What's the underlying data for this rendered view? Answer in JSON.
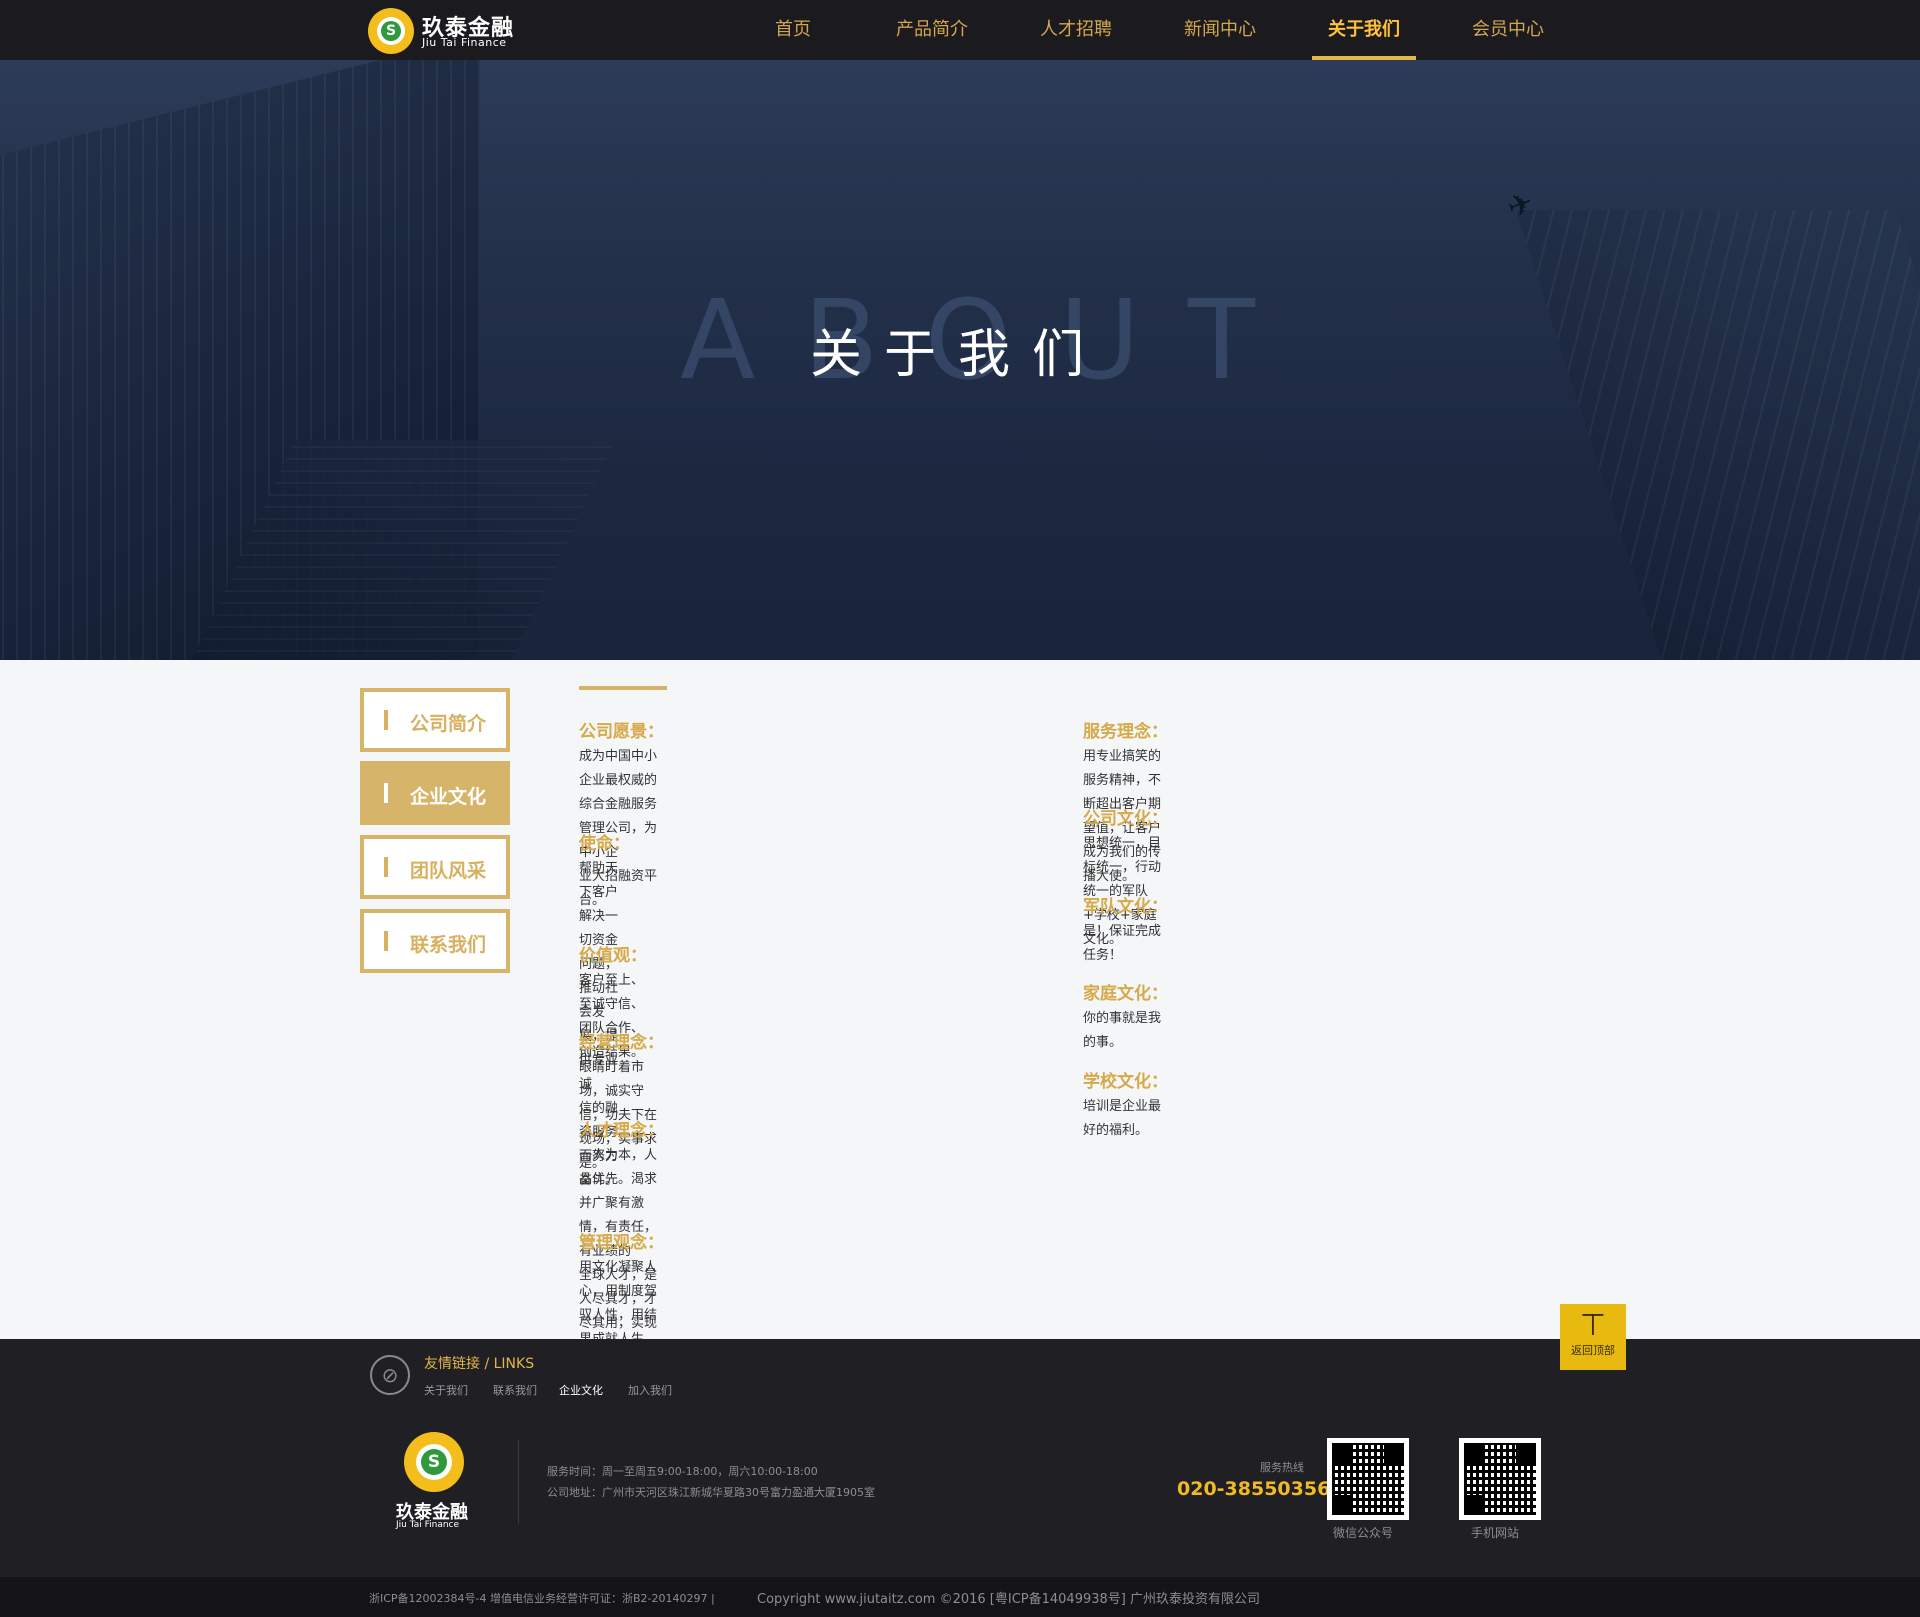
{
  "brand": {
    "name_cn": "玖泰金融",
    "name_en": "Jiu Tai Finance",
    "mark": "S",
    "accent_color": "#d6b56a",
    "nav_color": "#d4a64d"
  },
  "nav": {
    "items": [
      {
        "label": "首页"
      },
      {
        "label": "产品简介"
      },
      {
        "label": "人才招聘"
      },
      {
        "label": "新闻中心"
      },
      {
        "label": "关于我们",
        "active": true
      },
      {
        "label": "会员中心"
      }
    ]
  },
  "banner": {
    "bg_word": "ABOUT",
    "title": "关于我们",
    "plane_icon": "airplane-icon"
  },
  "sidebar": {
    "items": [
      {
        "label": "公司简介"
      },
      {
        "label": "企业文化",
        "active": true
      },
      {
        "label": "团队风采"
      },
      {
        "label": "联系我们"
      }
    ]
  },
  "culture": {
    "left": [
      {
        "title": "公司愿景：",
        "text": [
          "成为中国中小企业最权威的综合金融服务管理公司，为中小企",
          "业大招融资平台。"
        ]
      },
      {
        "title": "使命：",
        "text": [
          "帮助天下客户解决一切资金问题，推动社会发展，提供专业诚",
          "信的融资服务而努力奋斗。"
        ]
      },
      {
        "title": "价值观：",
        "text": [
          "客户至上、至诚守信、团队合作、创造结果。"
        ]
      },
      {
        "title": "经营理念：",
        "text": [
          "眼睛盯着市场，诚实守信；功夫下在现场，实事求是。"
        ]
      },
      {
        "title": "人才理念：",
        "text": [
          "一人为本，人品优先。渴求并广聚有激情，有责任，有业绩的",
          "全球人才，是人尽其才，才尽其用，实现员工与公司共同发展。"
        ]
      },
      {
        "title": "管理观念：",
        "text": [
          "用文化凝聚人心，用制度驾驭人性，用结果成就人生。"
        ]
      }
    ],
    "right": [
      {
        "title": "服务理念：",
        "text": [
          "用专业搞笑的服务精神，不断超出客户期望值，让客户成为我们的传播大使。"
        ]
      },
      {
        "title": "公司文化：",
        "text": [
          "思想统一，目标统一，行动统一的军队+学校+家庭文化。"
        ]
      },
      {
        "title": "军队文化：",
        "text": [
          "是！保证完成任务！"
        ]
      },
      {
        "title": "家庭文化：",
        "text": [
          "你的事就是我的事。"
        ]
      },
      {
        "title": "学校文化：",
        "text": [
          "培训是企业最好的福利。"
        ]
      }
    ]
  },
  "to_top": {
    "label": "返回顶部",
    "icon": "arrow-up-icon"
  },
  "footer": {
    "links_title": "友情链接 / LINKS",
    "links": [
      {
        "label": "关于我们"
      },
      {
        "label": "联系我们"
      },
      {
        "label": "企业文化",
        "current": true
      },
      {
        "label": "加入我们"
      }
    ],
    "service_time": "服务时间：周一至周五9:00-18:00，周六10:00-18:00",
    "address": "公司地址：广州市天河区珠江新城华夏路30号富力盈通大厦1905室",
    "hotline_label": "服务热线",
    "hotline": "020-38550356",
    "qr_wechat_label": "微信公众号",
    "qr_mobile_label": "手机网站",
    "icp_text": "浙ICP备12002384号-4  增值电信业务经营许可证：浙B2-20140297   |",
    "copyright": "Copyright www.jiutaitz.com ©2016 [粤ICP备14049938号] 广州玖泰投资有限公司"
  }
}
